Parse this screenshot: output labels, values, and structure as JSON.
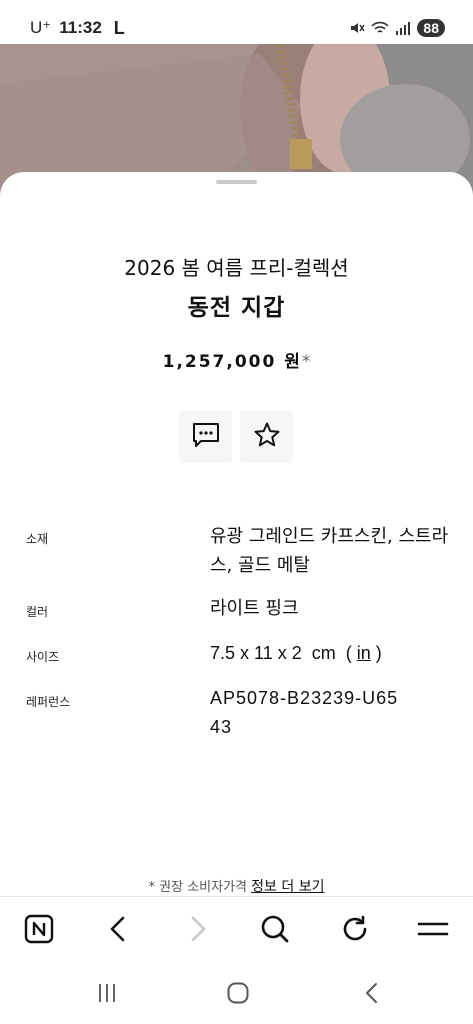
{
  "status_bar": {
    "carrier": "U⁺",
    "time": "11:32",
    "indicator": "L",
    "battery": "88",
    "icons": [
      "mute-icon",
      "wifi-icon",
      "signal-icon"
    ]
  },
  "product": {
    "collection": "2026 봄 여름 프리-컬렉션",
    "name": "동전 지갑",
    "price": "1,257,000 원",
    "price_mark": "*"
  },
  "actions": {
    "chat_icon": "chat-bubble-icon",
    "favorite_icon": "star-icon"
  },
  "specs": [
    {
      "label": "소재",
      "value": "유광 그레인드 카프스킨, 스트라스, 골드 메탈"
    },
    {
      "label": "컬러",
      "value": "라이트 핑크"
    },
    {
      "label": "사이즈",
      "value": "7.5 x 11 x 2  cm",
      "unit_link": "in"
    },
    {
      "label": "레퍼런스",
      "value": "AP5078-B23239-U6543"
    }
  ],
  "footnote": {
    "text": "* 권장 소비자가격",
    "link": "정보 더 보기"
  },
  "browser_toolbar": [
    "naver-home-icon",
    "back-icon",
    "forward-icon",
    "search-icon",
    "refresh-icon",
    "menu-icon"
  ],
  "system_nav": [
    "recents-icon",
    "home-icon",
    "back-icon"
  ],
  "colors": {
    "hero_background": "#8e8b8b",
    "product_pink": "#e8c8c0",
    "button_background": "#f7f6f6",
    "forward_disabled": "#c8c8c8"
  }
}
